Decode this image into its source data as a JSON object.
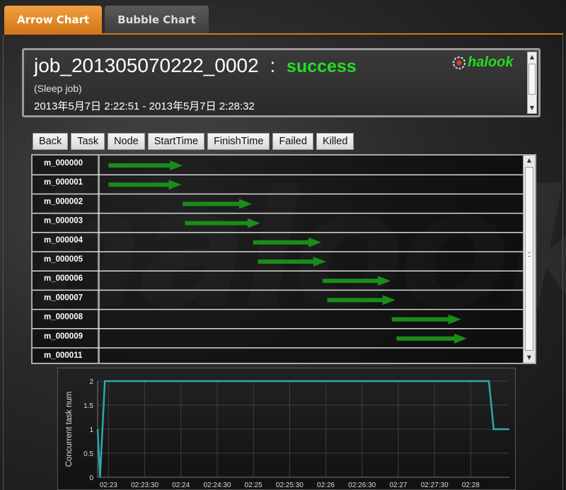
{
  "tabs": [
    {
      "label": "Arrow Chart",
      "active": true
    },
    {
      "label": "Bubble Chart",
      "active": false
    }
  ],
  "job": {
    "id": "job_201305070222_0002",
    "separator": ":",
    "status": "success",
    "name": "(Sleep job)",
    "time_range": "2013年5月7日 2:22:51 - 2013年5月7日 2:28:32",
    "logo_text": "halook"
  },
  "toolbar": {
    "buttons": [
      "Back",
      "Task",
      "Node",
      "StartTime",
      "FinishTime",
      "Failed",
      "Killed"
    ]
  },
  "watermark": "halook",
  "tasks": [
    {
      "name": "m_000000",
      "start": "02:22:53",
      "end": "02:23:55"
    },
    {
      "name": "m_000001",
      "start": "02:22:53",
      "end": "02:23:54"
    },
    {
      "name": "m_000002",
      "start": "02:23:55",
      "end": "02:24:53"
    },
    {
      "name": "m_000003",
      "start": "02:23:57",
      "end": "02:25:00"
    },
    {
      "name": "m_000004",
      "start": "02:24:54",
      "end": "02:25:51"
    },
    {
      "name": "m_000005",
      "start": "02:24:58",
      "end": "02:25:55"
    },
    {
      "name": "m_000006",
      "start": "02:25:52",
      "end": "02:26:49"
    },
    {
      "name": "m_000007",
      "start": "02:25:56",
      "end": "02:26:53"
    },
    {
      "name": "m_000008",
      "start": "02:26:50",
      "end": "02:27:48"
    },
    {
      "name": "m_000009",
      "start": "02:26:54",
      "end": "02:27:53"
    },
    {
      "name": "m_000011",
      "start": "",
      "end": ""
    }
  ],
  "colors": {
    "arrow": "#1a8c1a",
    "line": "#2ea8a8",
    "accent_tab": "#d2761a",
    "status": "#22e022"
  },
  "chart_data": {
    "type": "line",
    "ylabel": "Concurrent task num",
    "xlabel": "",
    "y_ticks": [
      "0",
      "0.5",
      "1",
      "1.5",
      "2"
    ],
    "ylim": [
      0,
      2
    ],
    "x_ticks": [
      "02:23",
      "02:23:30",
      "02:24",
      "02:24:30",
      "02:25",
      "02:25:30",
      "02:26",
      "02:26:30",
      "02:27",
      "02:27:30",
      "02:28"
    ],
    "xlim": [
      "02:22:51",
      "02:28:32"
    ],
    "grid": true,
    "series": [
      {
        "x": [
          "02:22:51",
          "02:22:53",
          "02:22:57",
          "02:28:15",
          "02:28:19",
          "02:28:32"
        ],
        "y": [
          1,
          0,
          2,
          2,
          1,
          1
        ]
      }
    ]
  }
}
